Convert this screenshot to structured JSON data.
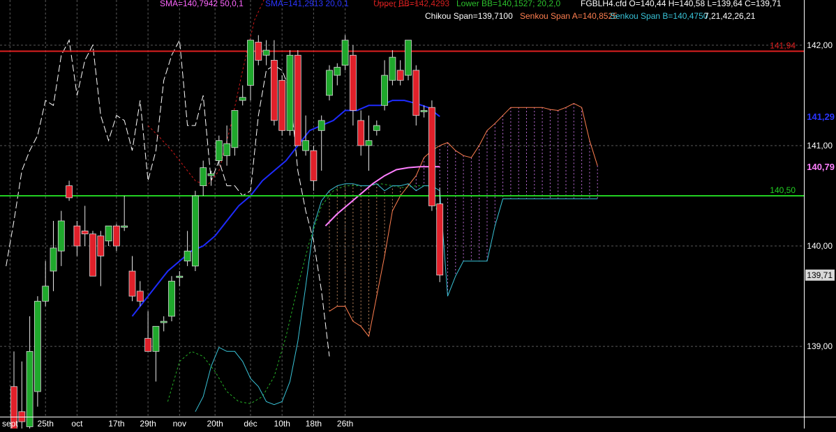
{
  "header": {
    "sma_50": "SMA=140,7942  50,0,1",
    "sma_20": "SMA=141,2913  20,0,1",
    "upper_bb": "Upper BB=142,4293",
    "lower_bb": "Lower BB=140,1527; 20,2,0",
    "ohlc": "FGBLH4.cfd O=140,44 H=140,58 L=139,64 C=139,71",
    "chikou": "Chikou Span=139,7100",
    "senkou_a": "Senkou Span A=140,8525",
    "senkou_b": "Senkou Span B=140,4750",
    "ichimoku_params": "7,21,42,26,21"
  },
  "colors": {
    "background": "#000000",
    "grid": "#5a5a5a",
    "bull": "#1fa82c",
    "bear": "#e0202a",
    "sma50": "#ff7fff",
    "sma20": "#1e2bff",
    "upper_bb": "#d01818",
    "lower_bb": "#26b026",
    "chikou": "#ffffff",
    "senkou_a": "#ff7f50",
    "senkou_b": "#39c4d8",
    "resistance": "#e02020",
    "support": "#22d022"
  },
  "chart_data": {
    "type": "candlestick",
    "instrument": "FGBLH4.cfd",
    "ylim": [
      138.3,
      142.45
    ],
    "x_ticks": [
      {
        "label": "sept",
        "i": -0.5
      },
      {
        "label": "25th",
        "i": 4
      },
      {
        "label": "oct",
        "i": 8
      },
      {
        "label": "17th",
        "i": 13
      },
      {
        "label": "29th",
        "i": 17
      },
      {
        "label": "nov",
        "i": 21
      },
      {
        "label": "20th",
        "i": 25.5
      },
      {
        "label": "déc",
        "i": 30
      },
      {
        "label": "10th",
        "i": 34
      },
      {
        "label": "18th",
        "i": 38
      },
      {
        "label": "26th",
        "i": 42
      }
    ],
    "y_ticks": [
      {
        "label": "139,00",
        "v": 139.0
      },
      {
        "label": "140,00",
        "v": 140.0
      },
      {
        "label": "141,00",
        "v": 141.0
      },
      {
        "label": "142,00",
        "v": 142.0
      }
    ],
    "horizontal_lines": [
      {
        "name": "resistance",
        "v": 141.94,
        "label": "141,94"
      },
      {
        "name": "support",
        "v": 140.5,
        "label": "140,50"
      }
    ],
    "right_labels": [
      {
        "name": "sma20-value",
        "v": 141.29,
        "label": "141,29"
      },
      {
        "name": "sma50-value",
        "v": 140.79,
        "label": "140,79"
      },
      {
        "name": "last-close",
        "v": 139.71,
        "label": "139,71"
      }
    ],
    "candles": [
      {
        "i": 0,
        "o": 138.6,
        "h": 138.95,
        "l": 138.15,
        "c": 138.15
      },
      {
        "i": 1,
        "o": 138.35,
        "h": 138.85,
        "l": 138.15,
        "c": 138.25
      },
      {
        "i": 2,
        "o": 138.2,
        "h": 139.3,
        "l": 138.1,
        "c": 138.95
      },
      {
        "i": 3,
        "o": 138.55,
        "h": 139.5,
        "l": 138.4,
        "c": 139.45
      },
      {
        "i": 4,
        "o": 139.45,
        "h": 139.85,
        "l": 139.4,
        "c": 139.6
      },
      {
        "i": 5,
        "o": 139.75,
        "h": 140.25,
        "l": 139.55,
        "c": 139.98
      },
      {
        "i": 6,
        "o": 139.95,
        "h": 140.35,
        "l": 139.8,
        "c": 140.25
      },
      {
        "i": 7,
        "o": 140.6,
        "h": 140.65,
        "l": 140.45,
        "c": 140.48
      },
      {
        "i": 8,
        "o": 140.2,
        "h": 140.25,
        "l": 139.9,
        "c": 140.0
      },
      {
        "i": 9,
        "o": 140.15,
        "h": 140.4,
        "l": 140.0,
        "c": 140.12
      },
      {
        "i": 10,
        "o": 140.12,
        "h": 140.15,
        "l": 139.7,
        "c": 139.7
      },
      {
        "i": 11,
        "o": 140.1,
        "h": 140.15,
        "l": 139.6,
        "c": 139.9
      },
      {
        "i": 12,
        "o": 140.05,
        "h": 140.15,
        "l": 140.0,
        "c": 140.2
      },
      {
        "i": 13,
        "o": 140.2,
        "h": 140.22,
        "l": 139.95,
        "c": 140.0
      },
      {
        "i": 14,
        "o": 140.2,
        "h": 140.5,
        "l": 140.15,
        "c": 140.2
      },
      {
        "i": 15,
        "o": 139.75,
        "h": 139.9,
        "l": 139.45,
        "c": 139.5
      },
      {
        "i": 16,
        "o": 139.55,
        "h": 139.65,
        "l": 139.4,
        "c": 139.45
      },
      {
        "i": 17,
        "o": 139.08,
        "h": 139.35,
        "l": 138.95,
        "c": 138.95
      },
      {
        "i": 18,
        "o": 138.95,
        "h": 139.1,
        "l": 138.65,
        "c": 139.2
      },
      {
        "i": 19,
        "o": 139.25,
        "h": 139.3,
        "l": 139.15,
        "c": 139.25
      },
      {
        "i": 20,
        "o": 139.3,
        "h": 139.7,
        "l": 139.25,
        "c": 139.65
      },
      {
        "i": 21,
        "o": 139.7,
        "h": 139.75,
        "l": 139.6,
        "c": 139.7
      },
      {
        "i": 22,
        "o": 139.85,
        "h": 140.15,
        "l": 139.8,
        "c": 139.95
      },
      {
        "i": 23,
        "o": 139.8,
        "h": 140.55,
        "l": 139.75,
        "c": 140.5
      },
      {
        "i": 24,
        "o": 140.6,
        "h": 140.85,
        "l": 140.5,
        "c": 140.78
      },
      {
        "i": 25,
        "o": 140.7,
        "h": 140.75,
        "l": 140.6,
        "c": 140.72
      },
      {
        "i": 26,
        "o": 140.85,
        "h": 141.1,
        "l": 140.8,
        "c": 141.05
      },
      {
        "i": 27,
        "o": 140.9,
        "h": 141.2,
        "l": 140.8,
        "c": 141.02
      },
      {
        "i": 28,
        "o": 140.98,
        "h": 141.35,
        "l": 140.9,
        "c": 141.35
      },
      {
        "i": 29,
        "o": 141.45,
        "h": 141.6,
        "l": 141.4,
        "c": 141.48
      },
      {
        "i": 30,
        "o": 141.6,
        "h": 142.05,
        "l": 141.45,
        "c": 142.05
      },
      {
        "i": 31,
        "o": 142.03,
        "h": 142.1,
        "l": 141.8,
        "c": 141.85
      },
      {
        "i": 32,
        "o": 141.9,
        "h": 142.05,
        "l": 141.8,
        "c": 141.95
      },
      {
        "i": 33,
        "o": 141.85,
        "h": 142.05,
        "l": 141.2,
        "c": 141.25
      },
      {
        "i": 34,
        "o": 141.65,
        "h": 141.7,
        "l": 141.1,
        "c": 141.15
      },
      {
        "i": 35,
        "o": 141.15,
        "h": 141.95,
        "l": 141.1,
        "c": 141.9
      },
      {
        "i": 36,
        "o": 141.9,
        "h": 141.95,
        "l": 141.0,
        "c": 141.0
      },
      {
        "i": 37,
        "o": 140.95,
        "h": 141.3,
        "l": 140.9,
        "c": 141.05
      },
      {
        "i": 38,
        "o": 140.95,
        "h": 141.0,
        "l": 140.55,
        "c": 140.65
      },
      {
        "i": 39,
        "o": 141.15,
        "h": 141.3,
        "l": 140.75,
        "c": 141.25
      },
      {
        "i": 40,
        "o": 141.5,
        "h": 141.8,
        "l": 141.45,
        "c": 141.75
      },
      {
        "i": 41,
        "o": 141.7,
        "h": 141.82,
        "l": 141.6,
        "c": 141.78
      },
      {
        "i": 42,
        "o": 141.8,
        "h": 142.1,
        "l": 141.75,
        "c": 142.05
      },
      {
        "i": 43,
        "o": 141.9,
        "h": 142.0,
        "l": 141.2,
        "c": 141.35
      },
      {
        "i": 44,
        "o": 141.25,
        "h": 141.35,
        "l": 140.9,
        "c": 141.0
      },
      {
        "i": 45,
        "o": 141.0,
        "h": 141.3,
        "l": 140.75,
        "c": 141.05
      },
      {
        "i": 46,
        "o": 141.15,
        "h": 141.25,
        "l": 141.1,
        "c": 141.2
      },
      {
        "i": 47,
        "o": 141.4,
        "h": 141.85,
        "l": 141.35,
        "c": 141.7
      },
      {
        "i": 48,
        "o": 141.65,
        "h": 141.95,
        "l": 141.6,
        "c": 141.88
      },
      {
        "i": 49,
        "o": 141.75,
        "h": 141.85,
        "l": 141.6,
        "c": 141.65
      },
      {
        "i": 50,
        "o": 141.7,
        "h": 142.05,
        "l": 141.65,
        "c": 142.05
      },
      {
        "i": 51,
        "o": 141.75,
        "h": 141.8,
        "l": 141.2,
        "c": 141.3
      },
      {
        "i": 52,
        "o": 141.35,
        "h": 141.4,
        "l": 141.28,
        "c": 141.35
      },
      {
        "i": 53,
        "o": 141.38,
        "h": 141.45,
        "l": 140.35,
        "c": 140.4
      },
      {
        "i": 54,
        "o": 140.42,
        "h": 140.58,
        "l": 139.64,
        "c": 139.71
      }
    ],
    "sma20": [
      [
        15,
        139.3
      ],
      [
        16.5,
        139.45
      ],
      [
        18,
        139.6
      ],
      [
        19.5,
        139.75
      ],
      [
        21,
        139.85
      ],
      [
        22.5,
        139.95
      ],
      [
        24,
        140.0
      ],
      [
        25.5,
        140.1
      ],
      [
        27,
        140.25
      ],
      [
        28.5,
        140.4
      ],
      [
        30,
        140.5
      ],
      [
        31.5,
        140.65
      ],
      [
        33,
        140.75
      ],
      [
        34.5,
        140.85
      ],
      [
        36,
        141.0
      ],
      [
        37.5,
        141.15
      ],
      [
        39,
        141.2
      ],
      [
        40.5,
        141.25
      ],
      [
        42,
        141.35
      ],
      [
        43.5,
        141.35
      ],
      [
        45,
        141.4
      ],
      [
        46.5,
        141.4
      ],
      [
        48,
        141.45
      ],
      [
        49.5,
        141.45
      ],
      [
        51,
        141.42
      ],
      [
        52.5,
        141.38
      ],
      [
        54,
        141.29
      ]
    ],
    "sma50": [
      [
        39.5,
        140.2
      ],
      [
        41,
        140.32
      ],
      [
        42.5,
        140.42
      ],
      [
        44,
        140.52
      ],
      [
        45.5,
        140.62
      ],
      [
        47,
        140.7
      ],
      [
        48.5,
        140.76
      ],
      [
        50,
        140.78
      ],
      [
        51.5,
        140.79
      ],
      [
        54,
        140.79
      ]
    ],
    "upper_bb": [
      [
        17,
        141.2
      ],
      [
        18.5,
        141.08
      ],
      [
        20,
        140.95
      ],
      [
        21.5,
        140.8
      ],
      [
        23,
        140.65
      ],
      [
        24.5,
        140.6
      ],
      [
        26,
        140.75
      ],
      [
        27.5,
        141.2
      ],
      [
        29,
        141.75
      ],
      [
        30.5,
        142.25
      ],
      [
        32,
        142.5
      ],
      [
        33.5,
        142.6
      ],
      [
        35,
        142.6
      ],
      [
        36.5,
        142.62
      ],
      [
        38,
        142.6
      ],
      [
        39.5,
        142.55
      ],
      [
        41,
        142.52
      ],
      [
        42.5,
        142.5
      ],
      [
        44,
        142.48
      ],
      [
        45.5,
        142.45
      ],
      [
        47,
        142.4
      ],
      [
        48.5,
        142.38
      ],
      [
        50,
        142.4
      ],
      [
        51.5,
        142.43
      ]
    ],
    "lower_bb": [
      [
        19.5,
        138.45
      ],
      [
        21,
        138.85
      ],
      [
        22.5,
        138.95
      ],
      [
        24,
        138.9
      ],
      [
        25.5,
        138.75
      ],
      [
        27,
        138.55
      ],
      [
        28.5,
        138.45
      ],
      [
        30,
        138.43
      ],
      [
        31.5,
        138.5
      ],
      [
        33,
        138.7
      ],
      [
        34.5,
        139.1
      ],
      [
        36,
        139.6
      ],
      [
        37.5,
        140.05
      ],
      [
        39,
        140.4
      ],
      [
        40.5,
        140.55
      ],
      [
        42,
        140.6
      ],
      [
        43.5,
        140.6
      ],
      [
        45,
        140.6
      ],
      [
        46.5,
        140.62
      ],
      [
        48,
        140.6
      ],
      [
        49.5,
        140.58
      ],
      [
        51,
        140.6
      ],
      [
        52.5,
        140.6
      ],
      [
        53.5,
        140.4
      ],
      [
        54,
        140.15
      ]
    ],
    "chikou": [
      [
        -1,
        139.8
      ],
      [
        0,
        140.25
      ],
      [
        1,
        140.75
      ],
      [
        2,
        140.95
      ],
      [
        3,
        141.1
      ],
      [
        4,
        141.45
      ],
      [
        5,
        141.4
      ],
      [
        6,
        141.9
      ],
      [
        7,
        142.05
      ],
      [
        8,
        141.5
      ],
      [
        9,
        141.85
      ],
      [
        10,
        142.0
      ],
      [
        11,
        141.3
      ],
      [
        12,
        141.05
      ],
      [
        13,
        141.3
      ],
      [
        14,
        141.25
      ],
      [
        15,
        140.95
      ],
      [
        16,
        141.45
      ],
      [
        17,
        140.65
      ],
      [
        18,
        140.95
      ],
      [
        19,
        141.65
      ],
      [
        20,
        141.9
      ],
      [
        21,
        142.05
      ],
      [
        22,
        141.2
      ],
      [
        23,
        141.2
      ],
      [
        24,
        141.5
      ],
      [
        25,
        140.65
      ],
      [
        26,
        140.85
      ],
      [
        27,
        140.6
      ],
      [
        28,
        140.6
      ],
      [
        29,
        140.5
      ],
      [
        30,
        140.55
      ],
      [
        31,
        141.3
      ],
      [
        32,
        141.75
      ],
      [
        33,
        141.8
      ],
      [
        34,
        141.75
      ],
      [
        35,
        141.55
      ],
      [
        36,
        140.75
      ],
      [
        37,
        140.35
      ],
      [
        38,
        140.05
      ],
      [
        39,
        139.55
      ],
      [
        40,
        138.9
      ]
    ],
    "senkou_a": [
      [
        40,
        139.35
      ],
      [
        41,
        139.4
      ],
      [
        42,
        139.4
      ],
      [
        43,
        139.25
      ],
      [
        44,
        139.2
      ],
      [
        45,
        139.1
      ],
      [
        46,
        139.5
      ],
      [
        47,
        139.9
      ],
      [
        48,
        140.35
      ],
      [
        49,
        140.5
      ],
      [
        50,
        140.6
      ],
      [
        51,
        140.7
      ],
      [
        52,
        140.88
      ],
      [
        53,
        140.95
      ],
      [
        54,
        141.0
      ],
      [
        55,
        141.03
      ],
      [
        56,
        140.95
      ],
      [
        57,
        140.9
      ],
      [
        58,
        140.88
      ],
      [
        59,
        141.0
      ],
      [
        60,
        141.15
      ],
      [
        61,
        141.22
      ],
      [
        62,
        141.3
      ],
      [
        63,
        141.38
      ],
      [
        64,
        141.38
      ],
      [
        65,
        141.38
      ],
      [
        66,
        141.38
      ],
      [
        67,
        141.38
      ],
      [
        68,
        141.36
      ],
      [
        69,
        141.35
      ],
      [
        70,
        141.38
      ],
      [
        71,
        141.42
      ],
      [
        72,
        141.38
      ],
      [
        73,
        141.05
      ],
      [
        74,
        140.8
      ]
    ],
    "senkou_b": [
      [
        23,
        138.35
      ],
      [
        24,
        138.5
      ],
      [
        25,
        138.8
      ],
      [
        26,
        138.99
      ],
      [
        27,
        138.95
      ],
      [
        28,
        138.95
      ],
      [
        29,
        138.85
      ],
      [
        30,
        138.68
      ],
      [
        31,
        138.6
      ],
      [
        32,
        138.45
      ],
      [
        33,
        138.42
      ],
      [
        34,
        138.45
      ],
      [
        35,
        138.65
      ],
      [
        36,
        139.05
      ],
      [
        37,
        139.6
      ],
      [
        38,
        140.2
      ],
      [
        39,
        140.45
      ],
      [
        40,
        140.55
      ],
      [
        41,
        140.6
      ],
      [
        42,
        140.62
      ],
      [
        43,
        140.62
      ],
      [
        44,
        140.6
      ],
      [
        45,
        140.6
      ],
      [
        46,
        140.62
      ],
      [
        47,
        140.55
      ],
      [
        48,
        140.6
      ],
      [
        49,
        140.6
      ],
      [
        50,
        140.62
      ],
      [
        51,
        140.55
      ],
      [
        52,
        140.6
      ],
      [
        53,
        140.6
      ],
      [
        54,
        140.55
      ],
      [
        55,
        139.5
      ],
      [
        56,
        139.7
      ],
      [
        57,
        139.85
      ],
      [
        58,
        139.85
      ],
      [
        59,
        139.85
      ],
      [
        60,
        139.85
      ],
      [
        61,
        140.2
      ],
      [
        62,
        140.47
      ],
      [
        63,
        140.47
      ],
      [
        64,
        140.47
      ],
      [
        65,
        140.47
      ],
      [
        66,
        140.47
      ],
      [
        67,
        140.47
      ],
      [
        68,
        140.47
      ],
      [
        69,
        140.47
      ],
      [
        70,
        140.47
      ],
      [
        71,
        140.47
      ],
      [
        72,
        140.47
      ],
      [
        73,
        140.47
      ],
      [
        74,
        140.47
      ]
    ]
  }
}
